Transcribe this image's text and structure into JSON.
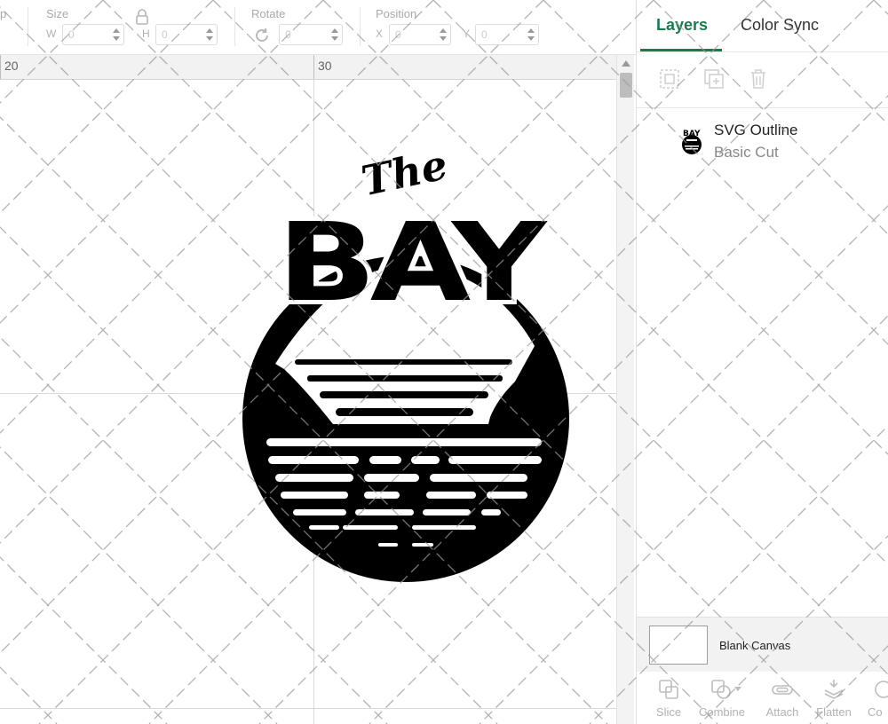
{
  "toolbar": {
    "partial_left": "p",
    "size_label": "Size",
    "w_label": "W",
    "h_label": "H",
    "w_value": "0",
    "h_value": "0",
    "rotate_label": "Rotate",
    "rotate_value": "0",
    "position_label": "Position",
    "x_label": "X",
    "y_label": "Y",
    "x_value": "0",
    "y_value": "0",
    "lock_icon": "lock-icon",
    "rotate_icon": "rotate-icon"
  },
  "canvas": {
    "ruler_labels": [
      "20",
      "30"
    ]
  },
  "artwork": {
    "script_text": "The",
    "title_text": "BAY"
  },
  "panel": {
    "tabs": [
      {
        "label": "Layers",
        "active": true
      },
      {
        "label": "Color Sync",
        "active": false
      }
    ],
    "layer_tools": [
      "group-icon",
      "duplicate-icon",
      "delete-icon"
    ],
    "layers": [
      {
        "name": "SVG Outline",
        "operation": "Basic Cut",
        "thumb_text": "BAY"
      }
    ],
    "blank_canvas_label": "Blank Canvas",
    "bottom_tools": [
      {
        "label": "Slice",
        "icon": "slice-icon"
      },
      {
        "label": "Combine",
        "icon": "combine-icon"
      },
      {
        "label": "Attach",
        "icon": "attach-icon"
      },
      {
        "label": "Flatten",
        "icon": "flatten-icon"
      },
      {
        "label": "Co",
        "icon": "contour-icon"
      }
    ]
  },
  "colors": {
    "accent": "#1d7a4f",
    "artwork": "#000000",
    "watermark": "#9a9a9a"
  }
}
